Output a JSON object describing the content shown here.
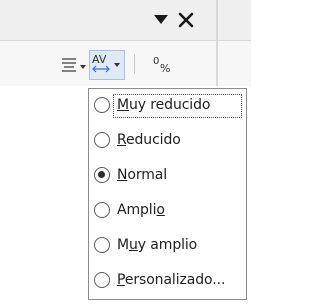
{
  "panel": {
    "titlebar": {
      "menu_icon": "triangle-down-icon",
      "close_icon": "close-x-icon"
    },
    "toolbar": {
      "align_icon": "align-lines-icon",
      "spacing_icon": "character-spacing-av-icon",
      "percent_icon": "percent-format-icon"
    }
  },
  "spacing_menu": {
    "items": [
      {
        "pre": "",
        "mn": "M",
        "post": "uy reducido",
        "checked": false,
        "highlight": true
      },
      {
        "pre": "",
        "mn": "R",
        "post": "educido",
        "checked": false,
        "highlight": false
      },
      {
        "pre": "",
        "mn": "N",
        "post": "ormal",
        "checked": true,
        "highlight": false
      },
      {
        "pre": "Ampli",
        "mn": "o",
        "post": "",
        "checked": false,
        "highlight": false
      },
      {
        "pre": "M",
        "mn": "u",
        "post": "y amplio",
        "checked": false,
        "highlight": false
      },
      {
        "pre": "",
        "mn": "P",
        "post": "ersonalizado...",
        "checked": false,
        "highlight": false
      }
    ]
  },
  "colors": {
    "selected_button_bg": "#dfeaf6",
    "selected_button_border": "#a7c1de",
    "spacing_icon_accent": "#2f6fd0"
  }
}
